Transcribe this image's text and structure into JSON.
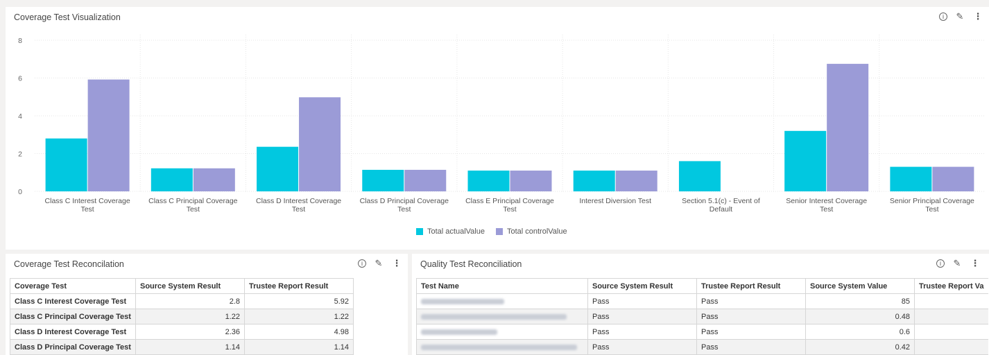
{
  "chart_panel": {
    "title": "Coverage Test Visualization"
  },
  "coverage_panel": {
    "title": "Coverage Test Reconcilation",
    "headers": [
      "Coverage Test",
      "Source System Result",
      "Trustee Report Result"
    ],
    "rows": [
      [
        "Class C Interest Coverage Test",
        "2.8",
        "5.92"
      ],
      [
        "Class C Principal Coverage Test",
        "1.22",
        "1.22"
      ],
      [
        "Class D Interest Coverage Test",
        "2.36",
        "4.98"
      ],
      [
        "Class D Principal Coverage Test",
        "1.14",
        "1.14"
      ]
    ]
  },
  "quality_panel": {
    "title": "Quality Test Reconciliation",
    "headers": [
      "Test Name",
      "Source System Result",
      "Trustee Report Result",
      "Source System Value",
      "Trustee Report Va"
    ],
    "rows": [
      [
        "",
        "Pass",
        "Pass",
        "85",
        ""
      ],
      [
        "",
        "Pass",
        "Pass",
        "0.48",
        ""
      ],
      [
        "",
        "Pass",
        "Pass",
        "0.6",
        ""
      ],
      [
        "",
        "Pass",
        "Pass",
        "0.42",
        ""
      ]
    ]
  },
  "icons": {
    "info": "info-icon",
    "edit": "pencil-icon",
    "more": "more-vertical-icon"
  },
  "chart_data": {
    "type": "bar",
    "categories": [
      "Class C Interest Coverage Test",
      "Class C Principal Coverage Test",
      "Class D Interest Coverage Test",
      "Class D Principal Coverage Test",
      "Class E Principal Coverage Test",
      "Interest Diversion Test",
      "Section 5.1(c) - Event of Default",
      "Senior Interest Coverage Test",
      "Senior Principal Coverage Test"
    ],
    "category_lines": [
      [
        "Class C Interest Coverage",
        "Test"
      ],
      [
        "Class C Principal Coverage",
        "Test"
      ],
      [
        "Class D Interest Coverage",
        "Test"
      ],
      [
        "Class D Principal Coverage",
        "Test"
      ],
      [
        "Class E Principal Coverage",
        "Test"
      ],
      [
        "Interest Diversion Test"
      ],
      [
        "Section 5.1(c) - Event of",
        "Default"
      ],
      [
        "Senior Interest Coverage",
        "Test"
      ],
      [
        "Senior Principal Coverage",
        "Test"
      ]
    ],
    "series": [
      {
        "name": "Total actualValue",
        "color": "#01c8e0",
        "values": [
          2.8,
          1.22,
          2.36,
          1.14,
          1.1,
          1.1,
          1.6,
          3.2,
          1.3
        ]
      },
      {
        "name": "Total controlValue",
        "color": "#9b9bd7",
        "values": [
          5.92,
          1.22,
          4.98,
          1.14,
          1.1,
          1.1,
          null,
          6.75,
          1.3
        ]
      }
    ],
    "yticks": [
      0,
      2,
      4,
      6,
      8
    ],
    "ylim": [
      0,
      8
    ],
    "grid": true,
    "legend": "bottom-center"
  }
}
